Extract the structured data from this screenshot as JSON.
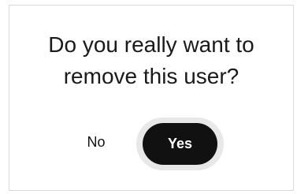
{
  "dialog": {
    "message_line1": "Do you really want to",
    "message_line2": "remove this user?",
    "no_label": "No",
    "yes_label": "Yes"
  },
  "colors": {
    "primary_button": "#111111",
    "primary_button_text": "#ffffff",
    "focus_ring": "#e8e8e8",
    "border": "#d9d9d9"
  }
}
